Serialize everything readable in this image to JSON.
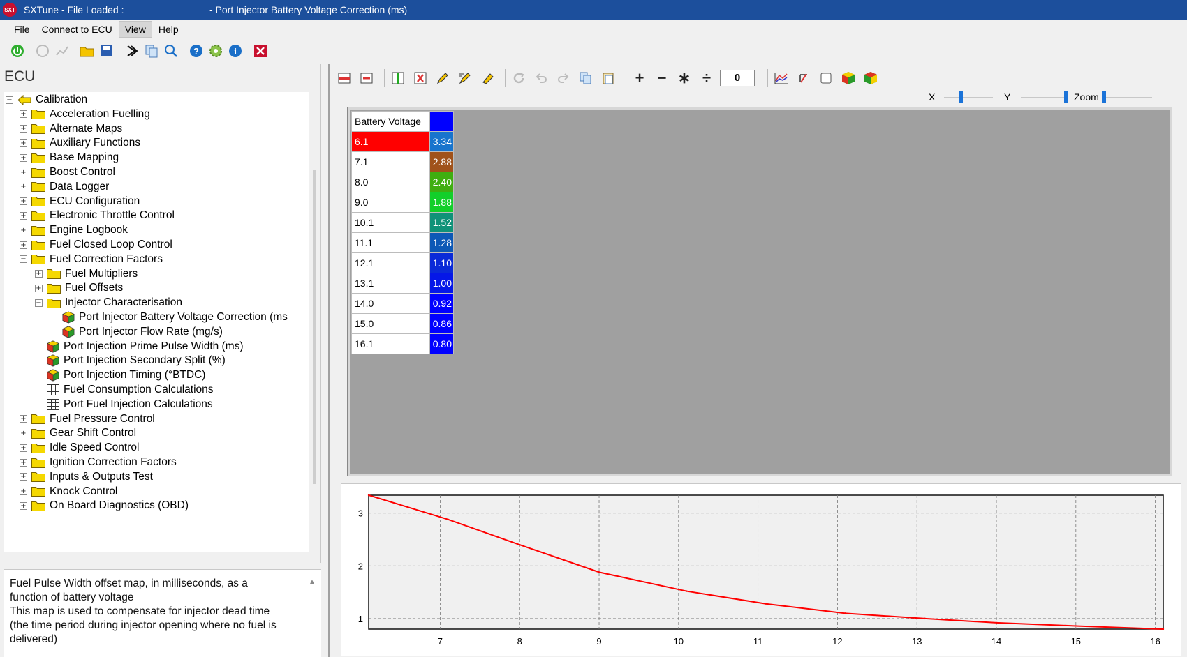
{
  "window": {
    "title_left": "SXTune - File Loaded :",
    "title_right": "- Port Injector Battery Voltage Correction (ms)",
    "logo_text": "SXT"
  },
  "menu": [
    "File",
    "Connect to ECU",
    "View",
    "Help"
  ],
  "menu_active": "View",
  "toolbar_icons": [
    "power-green-icon",
    "connect-icon",
    "chart-disabled-icon",
    "open-folder-icon",
    "save-icon",
    "download-icon",
    "copy-icon",
    "search-icon",
    "help-icon",
    "settings-icon",
    "info-icon",
    "close-red-icon"
  ],
  "left_pane": {
    "title": "ECU",
    "tree": [
      {
        "label": "Calibration",
        "level": 0,
        "icon": "calibration",
        "expander": "−"
      },
      {
        "label": "Acceleration Fuelling",
        "level": 1,
        "icon": "folder",
        "expander": "+"
      },
      {
        "label": "Alternate Maps",
        "level": 1,
        "icon": "folder",
        "expander": "+"
      },
      {
        "label": "Auxiliary Functions",
        "level": 1,
        "icon": "folder",
        "expander": "+"
      },
      {
        "label": "Base Mapping",
        "level": 1,
        "icon": "folder",
        "expander": "+"
      },
      {
        "label": "Boost Control",
        "level": 1,
        "icon": "folder",
        "expander": "+"
      },
      {
        "label": "Data Logger",
        "level": 1,
        "icon": "folder",
        "expander": "+"
      },
      {
        "label": "ECU Configuration",
        "level": 1,
        "icon": "folder",
        "expander": "+"
      },
      {
        "label": "Electronic Throttle Control",
        "level": 1,
        "icon": "folder",
        "expander": "+"
      },
      {
        "label": "Engine Logbook",
        "level": 1,
        "icon": "folder",
        "expander": "+"
      },
      {
        "label": "Fuel Closed Loop Control",
        "level": 1,
        "icon": "folder",
        "expander": "+"
      },
      {
        "label": "Fuel Correction Factors",
        "level": 1,
        "icon": "folder",
        "expander": "−"
      },
      {
        "label": "Fuel Multipliers",
        "level": 2,
        "icon": "folder",
        "expander": "+"
      },
      {
        "label": "Fuel Offsets",
        "level": 2,
        "icon": "folder",
        "expander": "+"
      },
      {
        "label": "Injector Characterisation",
        "level": 2,
        "icon": "folder",
        "expander": "−"
      },
      {
        "label": "Port Injector Battery Voltage Correction (ms",
        "level": 3,
        "icon": "cube",
        "expander": "",
        "selected": true
      },
      {
        "label": "Port Injector Flow Rate (mg/s)",
        "level": 3,
        "icon": "cube",
        "expander": ""
      },
      {
        "label": "Port Injection Prime Pulse Width (ms)",
        "level": 2,
        "icon": "cube",
        "expander": ""
      },
      {
        "label": "Port Injection Secondary Split (%)",
        "level": 2,
        "icon": "cube",
        "expander": ""
      },
      {
        "label": "Port Injection Timing (°BTDC)",
        "level": 2,
        "icon": "cube",
        "expander": ""
      },
      {
        "label": "Fuel Consumption Calculations",
        "level": 2,
        "icon": "grid",
        "expander": ""
      },
      {
        "label": "Port Fuel Injection Calculations",
        "level": 2,
        "icon": "grid",
        "expander": ""
      },
      {
        "label": "Fuel Pressure Control",
        "level": 1,
        "icon": "folder",
        "expander": "+"
      },
      {
        "label": "Gear Shift Control",
        "level": 1,
        "icon": "folder",
        "expander": "+"
      },
      {
        "label": "Idle Speed Control",
        "level": 1,
        "icon": "folder",
        "expander": "+"
      },
      {
        "label": "Ignition Correction Factors",
        "level": 1,
        "icon": "folder",
        "expander": "+"
      },
      {
        "label": "Inputs & Outputs Test",
        "level": 1,
        "icon": "folder",
        "expander": "+"
      },
      {
        "label": "Knock Control",
        "level": 1,
        "icon": "folder",
        "expander": "+"
      },
      {
        "label": "On Board Diagnostics (OBD)",
        "level": 1,
        "icon": "folder",
        "expander": "+"
      }
    ],
    "description": "Fuel Pulse Width offset map, in milliseconds, as a\nfunction of battery voltage\nThis map is used to compensate for injector dead time\n(the time period during injector opening where no fuel is\ndelivered)"
  },
  "table_toolbar": {
    "icons": [
      "insert-row-icon",
      "delete-row-icon",
      "insert-column-icon",
      "delete-column-icon",
      "edit-pen-icon",
      "edit-multiple-icon",
      "eraser-icon",
      "refresh-icon",
      "undo-icon",
      "redo-icon",
      "copy-icon",
      "paste-icon"
    ],
    "operators": [
      "+",
      "−",
      "∗",
      "÷"
    ],
    "value": "0",
    "view_icons": [
      "graph-icon",
      "rotate-icon",
      "checkbox-icon",
      "cube-3d-icon",
      "cube-3d-alt-icon"
    ]
  },
  "sliders": {
    "x_label": "X",
    "y_label": "Y",
    "zoom_label": "Zoom",
    "x_value": 0.33,
    "y_value": 1.0,
    "zoom_value": 0.0
  },
  "grid": {
    "axis_header": "Battery Voltage",
    "header_color": "#0000ff",
    "rows": [
      {
        "axis": "6.1",
        "value": "3.34",
        "color": "#1874cd",
        "selected": true
      },
      {
        "axis": "7.1",
        "value": "2.88",
        "color": "#a0521a"
      },
      {
        "axis": "8.0",
        "value": "2.40",
        "color": "#3fae10"
      },
      {
        "axis": "9.0",
        "value": "1.88",
        "color": "#12cf2a"
      },
      {
        "axis": "10.1",
        "value": "1.52",
        "color": "#0f9278"
      },
      {
        "axis": "11.1",
        "value": "1.28",
        "color": "#0d58b6"
      },
      {
        "axis": "12.1",
        "value": "1.10",
        "color": "#0a2ad8"
      },
      {
        "axis": "13.1",
        "value": "1.00",
        "color": "#0517e8"
      },
      {
        "axis": "14.0",
        "value": "0.92",
        "color": "#0000ff"
      },
      {
        "axis": "15.0",
        "value": "0.86",
        "color": "#0000ff"
      },
      {
        "axis": "16.1",
        "value": "0.80",
        "color": "#0000ff"
      }
    ]
  },
  "chart_data": {
    "type": "line",
    "x": [
      6.1,
      7.1,
      8.0,
      9.0,
      10.1,
      11.1,
      12.1,
      13.1,
      14.0,
      15.0,
      16.1
    ],
    "series": [
      {
        "values": [
          3.34,
          2.88,
          2.4,
          1.88,
          1.52,
          1.28,
          1.1,
          1.0,
          0.92,
          0.86,
          0.8
        ],
        "color": "#ff0000"
      }
    ],
    "xlim": [
      6.1,
      16.1
    ],
    "ylim": [
      0.8,
      3.34
    ],
    "xticks": [
      7,
      8,
      9,
      10,
      11,
      12,
      13,
      14,
      15,
      16
    ],
    "yticks": [
      1,
      2,
      3
    ],
    "grid": true,
    "title": "",
    "xlabel": "",
    "ylabel": ""
  }
}
